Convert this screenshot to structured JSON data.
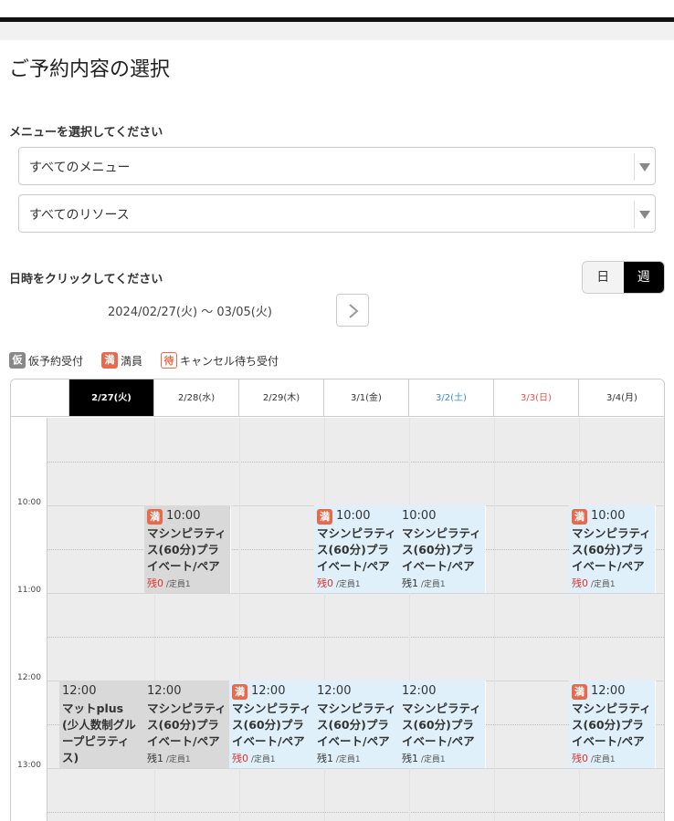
{
  "page": {
    "title": "ご予約内容の選択",
    "menu_label": "メニューを選択してください",
    "menu_select_value": "すべてのメニュー",
    "resource_select_value": "すべてのリソース",
    "date_label": "日時をクリックしてください",
    "view_toggle": {
      "day": "日",
      "week": "週",
      "selected": "週"
    },
    "date_range": "2024/02/27(火) 〜 03/05(火)"
  },
  "legend": [
    {
      "badge": "仮",
      "text": "仮予約受付"
    },
    {
      "badge": "満",
      "text": "満員"
    },
    {
      "badge": "待",
      "text": "キャンセル待ち受付"
    }
  ],
  "calendar": {
    "days": [
      {
        "label": "2/27(火)",
        "selected": true,
        "kind": "weekday"
      },
      {
        "label": "2/28(水)",
        "selected": false,
        "kind": "weekday"
      },
      {
        "label": "2/29(木)",
        "selected": false,
        "kind": "weekday"
      },
      {
        "label": "3/1(金)",
        "selected": false,
        "kind": "weekday"
      },
      {
        "label": "3/2(土)",
        "selected": false,
        "kind": "sat"
      },
      {
        "label": "3/3(日)",
        "selected": false,
        "kind": "sun"
      },
      {
        "label": "3/4(月)",
        "selected": false,
        "kind": "weekday"
      }
    ],
    "time_labels": [
      "10:00",
      "11:00",
      "12:00",
      "13:00"
    ],
    "remain_prefix": "残",
    "capacity_prefix": "/定員",
    "full_badge": "満",
    "slots": [
      {
        "day": 1,
        "row": "10",
        "time": "10:00",
        "title": "マシンピラティス(60分)プライベート/ペア",
        "full": true,
        "remain": 0,
        "capacity": 1,
        "style": "gray"
      },
      {
        "day": 3,
        "row": "10",
        "time": "10:00",
        "title": "マシンピラティス(60分)プライベート/ペア",
        "full": true,
        "remain": 0,
        "capacity": 1,
        "style": "blue"
      },
      {
        "day": 4,
        "row": "10",
        "time": "10:00",
        "title": "マシンピラティス(60分)プライベート/ペア",
        "full": false,
        "remain": 1,
        "capacity": 1,
        "style": "blue"
      },
      {
        "day": 6,
        "row": "10",
        "time": "10:00",
        "title": "マシンピラティス(60分)プライベート/ペア",
        "full": true,
        "remain": 0,
        "capacity": 1,
        "style": "blue"
      },
      {
        "day": 0,
        "row": "12",
        "time": "12:00",
        "title": "マットplus (少人数制グループピラティス)",
        "full": false,
        "remain": 1,
        "capacity": 4,
        "style": "gray"
      },
      {
        "day": 1,
        "row": "12",
        "time": "12:00",
        "title": "マシンピラティス(60分)プライベート/ペア",
        "full": false,
        "remain": 1,
        "capacity": 1,
        "style": "gray"
      },
      {
        "day": 2,
        "row": "12",
        "time": "12:00",
        "title": "マシンピラティス(60分)プライベート/ペア",
        "full": true,
        "remain": 0,
        "capacity": 1,
        "style": "blue"
      },
      {
        "day": 3,
        "row": "12",
        "time": "12:00",
        "title": "マシンピラティス(60分)プライベート/ペア",
        "full": false,
        "remain": 1,
        "capacity": 1,
        "style": "blue"
      },
      {
        "day": 4,
        "row": "12",
        "time": "12:00",
        "title": "マシンピラティス(60分)プライベート/ペア",
        "full": false,
        "remain": 1,
        "capacity": 1,
        "style": "blue"
      },
      {
        "day": 6,
        "row": "12",
        "time": "12:00",
        "title": "マシンピラティス(60分)プライベート/ペア",
        "full": true,
        "remain": 0,
        "capacity": 1,
        "style": "blue"
      }
    ]
  }
}
